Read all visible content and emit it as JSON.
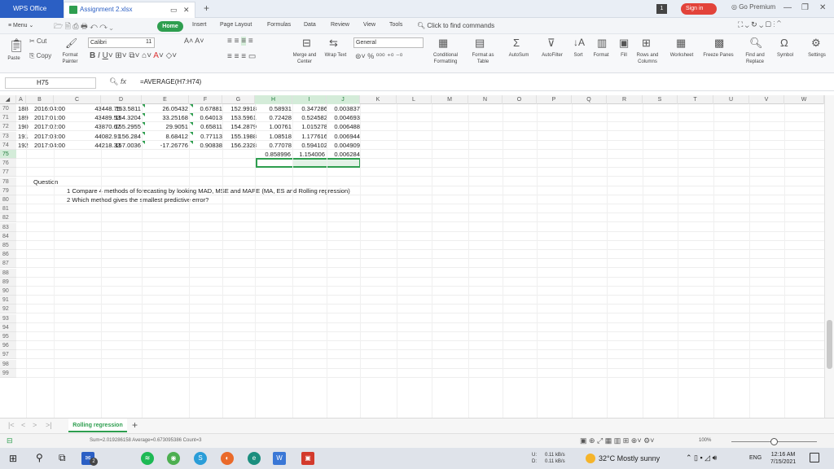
{
  "titlebar": {
    "app_name": "WPS Office",
    "doc_tab": "Assignment 2.xlsx",
    "badge": "1",
    "signin": "Sign in",
    "premium": "Go Premium"
  },
  "menu": {
    "menu_label": "Menu",
    "home": "Home",
    "items": [
      "Insert",
      "Page Layout",
      "Formulas",
      "Data",
      "Review",
      "View",
      "Tools"
    ],
    "search": "Click to find commands"
  },
  "ribbon": {
    "cut": "Cut",
    "copy": "Copy",
    "paste": "Paste",
    "format_painter": "Format Painter",
    "font_name": "Calibri",
    "font_size": "11",
    "number_format": "General",
    "merge": "Merge and Center",
    "wrap": "Wrap Text",
    "cond_format": "Conditional Formatting",
    "format_table": "Format as Table",
    "autosum": "AutoSum",
    "autofilter": "AutoFilter",
    "sort": "Sort",
    "format": "Format",
    "fill": "Fill",
    "rows_cols": "Rows and Columns",
    "worksheet": "Worksheet",
    "freeze": "Freeze Panes",
    "find_replace": "Find and Replace",
    "symbol": "Symbol",
    "settings": "Settings"
  },
  "formula_bar": {
    "cell_ref": "H75",
    "fx": "fx",
    "formula": "=AVERAGE(H7:H74)"
  },
  "columns": [
    "A",
    "B",
    "C",
    "D",
    "E",
    "F",
    "G",
    "H",
    "I",
    "J",
    "K",
    "L",
    "M",
    "N",
    "O",
    "P",
    "Q",
    "R",
    "S",
    "T",
    "U",
    "V",
    "W"
  ],
  "rows": [
    {
      "n": "70",
      "b": "188",
      "c": "2016:04:00",
      "d": "43448.75",
      "e": "153.5811",
      "f": "26.05432",
      "g": "0.67881",
      "h": "152.9918",
      "i": "0.58931",
      "j": "0.347286",
      "k": "0.003837"
    },
    {
      "n": "71",
      "b": "189",
      "c": "2017:01:00",
      "d": "43489.53",
      "e": "154.3204",
      "f": "33.25168",
      "g": "0.64013",
      "h": "153.5961",
      "i": "0.72428",
      "j": "0.524582",
      "k": "0.004693"
    },
    {
      "n": "72",
      "b": "190",
      "c": "2017:02:00",
      "d": "43870.67",
      "e": "155.2955",
      "f": "29.9051",
      "g": "0.65811",
      "h": "154.2879",
      "i": "1.00761",
      "j": "1.015278",
      "k": "0.006488"
    },
    {
      "n": "73",
      "b": "191",
      "c": "2017:03:00",
      "d": "44082.91",
      "e": "156.284",
      "f": "8.68412",
      "g": "0.77113",
      "h": "155.1988",
      "i": "1.08518",
      "j": "1.177616",
      "k": "0.006944"
    },
    {
      "n": "74",
      "b": "192",
      "c": "2017:04:00",
      "d": "44218.33",
      "e": "157.0036",
      "f": "-17.26776",
      "g": "0.90838",
      "h": "156.2328",
      "i": "0.77078",
      "j": "0.594102",
      "k": "0.004909"
    }
  ],
  "row75": {
    "n": "75",
    "h": "0.858996",
    "i": "1.154006",
    "j": "0.006284"
  },
  "empty_rows": [
    "76",
    "77",
    "78",
    "79",
    "80",
    "81",
    "82",
    "83",
    "84",
    "85",
    "86",
    "87",
    "88",
    "89",
    "90",
    "91",
    "92",
    "93",
    "94",
    "95",
    "96",
    "97",
    "98",
    "99"
  ],
  "question": {
    "title": "Question",
    "line1": "1 Compare 4 methods of forecasting by looking MAD, MSE and MAPE (MA, ES and Rolling regression)",
    "line2": "2 Which method gives the smallest predictive error?"
  },
  "sheet": {
    "tab": "Rolling regression"
  },
  "status": {
    "summary": "Sum=2.019286158  Average=0.673095386  Count=3",
    "zoom": "100%"
  },
  "taskbar": {
    "net_up_label": "U:",
    "net_up": "0.11 kB/s",
    "net_down_label": "D:",
    "net_down": "0.11 kB/s",
    "weather": "32°C  Mostly sunny",
    "lang": "ENG",
    "time": "12:16 AM",
    "date": "7/15/2021",
    "badge": "2"
  }
}
